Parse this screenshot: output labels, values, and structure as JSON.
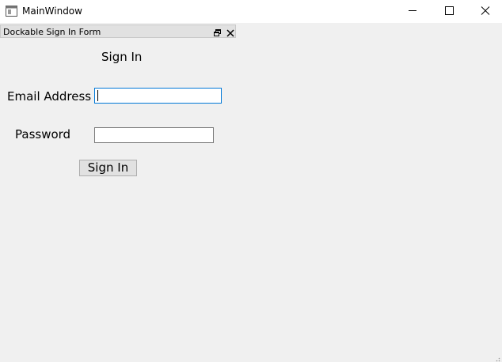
{
  "window": {
    "title": "MainWindow"
  },
  "dock": {
    "title": "Dockable Sign In Form"
  },
  "form": {
    "heading": "Sign In",
    "email_label": "Email Address",
    "email_value": "",
    "password_label": "Password",
    "password_value": "",
    "submit_label": "Sign In"
  },
  "icons": {
    "app": "app-window-icon",
    "minimize": "minimize-icon",
    "maximize": "maximize-icon",
    "close": "close-icon",
    "dock_float": "float-icon",
    "dock_close": "close-icon",
    "resize": "resize-grip-icon"
  },
  "colors": {
    "focus_border": "#0078d7",
    "background": "#f0f0f0"
  }
}
